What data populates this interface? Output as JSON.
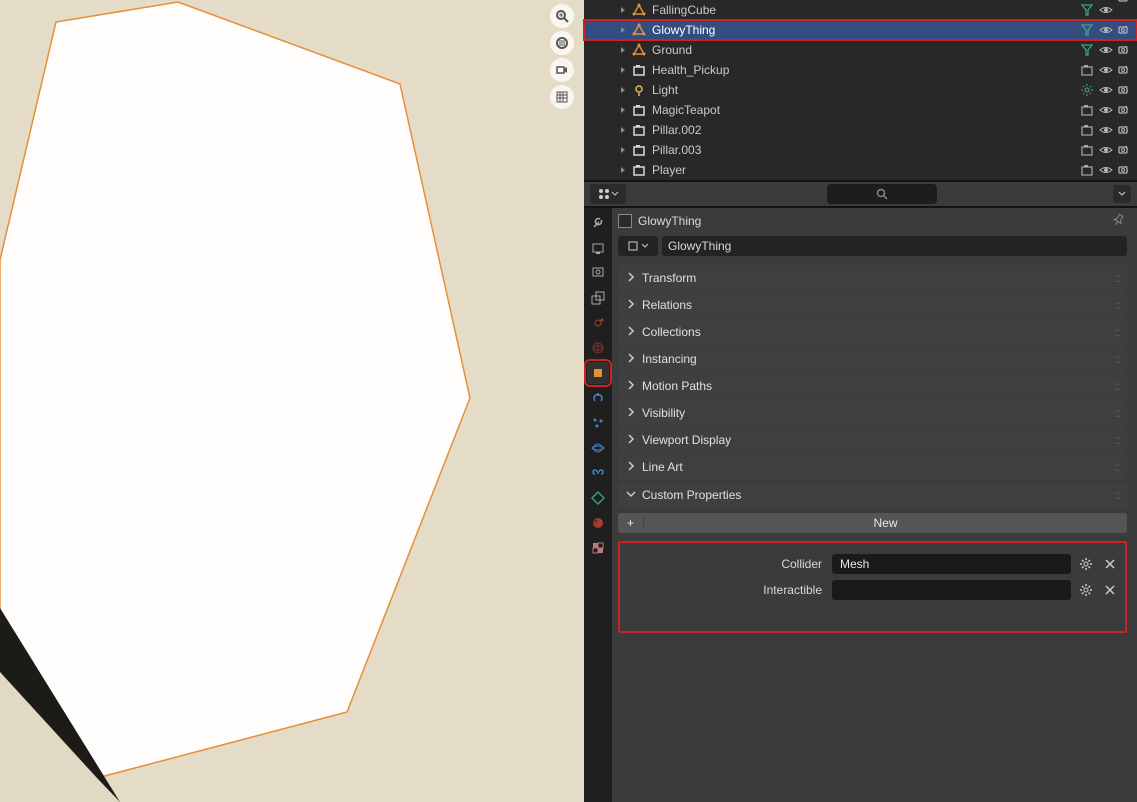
{
  "outliner": {
    "items": [
      {
        "label": "FallingCube",
        "icon": "mesh",
        "indent": 2,
        "deco": true,
        "camcut": true
      },
      {
        "label": "GlowyThing",
        "icon": "mesh",
        "indent": 2,
        "deco": true,
        "selected": true,
        "red": true
      },
      {
        "label": "Ground",
        "icon": "mesh",
        "indent": 2,
        "deco": true
      },
      {
        "label": "Health_Pickup",
        "icon": "collection",
        "indent": 2,
        "coll": true
      },
      {
        "label": "Light",
        "icon": "light",
        "indent": 2,
        "decolight": true
      },
      {
        "label": "MagicTeapot",
        "icon": "collection",
        "indent": 2,
        "coll": true
      },
      {
        "label": "Pillar.002",
        "icon": "collection",
        "indent": 2,
        "coll": true
      },
      {
        "label": "Pillar.003",
        "icon": "collection",
        "indent": 2,
        "coll": true
      },
      {
        "label": "Player",
        "icon": "collection",
        "indent": 2,
        "coll": true
      }
    ]
  },
  "crumb_name": "GlowyThing",
  "datablock_name": "GlowyThing",
  "panels": [
    "Transform",
    "Relations",
    "Collections",
    "Instancing",
    "Motion Paths",
    "Visibility",
    "Viewport Display",
    "Line Art"
  ],
  "custom_panel_label": "Custom Properties",
  "new_btn": "New",
  "custom_props": [
    {
      "label": "Collider",
      "value": "Mesh"
    },
    {
      "label": "Interactible",
      "value": ""
    }
  ]
}
